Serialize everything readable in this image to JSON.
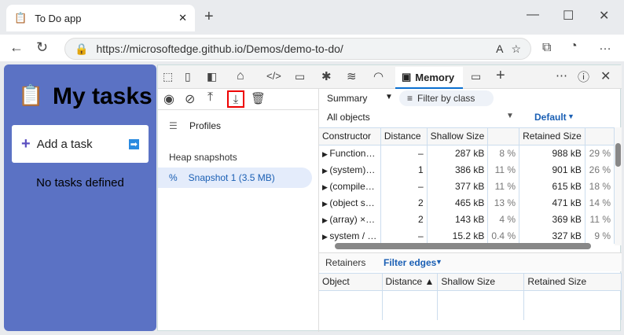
{
  "browser": {
    "tab_title": "To Do app",
    "url": "https://microsoftedge.github.io/Demos/demo-to-do/"
  },
  "app": {
    "title": "My tasks",
    "add_task": "Add a task",
    "empty": "No tasks defined"
  },
  "devtools": {
    "active_tab": "Memory",
    "sidebar": {
      "profiles": "Profiles",
      "heap_snapshots": "Heap snapshots",
      "snapshot": "Snapshot 1 (3.5 MB)"
    },
    "summary": "Summary",
    "filter_placeholder": "Filter by class",
    "all_objects": "All objects",
    "default": "Default",
    "columns": [
      "Constructor",
      "Distance",
      "Shallow Size",
      "",
      "Retained Size",
      ""
    ],
    "rows": [
      [
        "Function…",
        "–",
        "287 kB",
        "8 %",
        "988 kB",
        "29 %"
      ],
      [
        "(system)…",
        "1",
        "386 kB",
        "11 %",
        "901 kB",
        "26 %"
      ],
      [
        "(compile…",
        "–",
        "377 kB",
        "11 %",
        "615 kB",
        "18 %"
      ],
      [
        "(object s…",
        "2",
        "465 kB",
        "13 %",
        "471 kB",
        "14 %"
      ],
      [
        "(array)  ×…",
        "2",
        "143 kB",
        "4 %",
        "369 kB",
        "11 %"
      ],
      [
        "system / …",
        "–",
        "15.2 kB",
        "0.4 %",
        "327 kB",
        "9 %"
      ]
    ],
    "retainers": "Retainers",
    "filter_edges": "Filter edges",
    "ret_columns": [
      "Object",
      "Distance ▲",
      "Shallow Size",
      "Retained Size"
    ]
  }
}
